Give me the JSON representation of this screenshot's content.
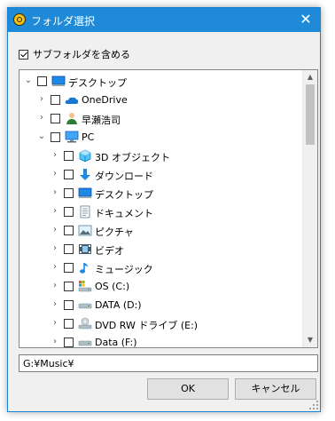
{
  "window": {
    "title": "フォルダ選択",
    "close_glyph": "✕"
  },
  "subfolders": {
    "label": "サブフォルダを含める",
    "checked": true
  },
  "tree": {
    "items": [
      {
        "label": "デスクトップ",
        "icon": "desktop-icon",
        "level": 0,
        "expanded": true
      },
      {
        "label": "OneDrive",
        "icon": "onedrive-cloud-icon",
        "level": 1,
        "expanded": false
      },
      {
        "label": "早瀬浩司",
        "icon": "user-folder-icon",
        "level": 1,
        "expanded": false
      },
      {
        "label": "PC",
        "icon": "pc-icon",
        "level": 1,
        "expanded": true
      },
      {
        "label": "3D オブジェクト",
        "icon": "3d-objects-icon",
        "level": 2,
        "expanded": false
      },
      {
        "label": "ダウンロード",
        "icon": "downloads-icon",
        "level": 2,
        "expanded": false
      },
      {
        "label": "デスクトップ",
        "icon": "desktop-icon",
        "level": 2,
        "expanded": false
      },
      {
        "label": "ドキュメント",
        "icon": "documents-icon",
        "level": 2,
        "expanded": false
      },
      {
        "label": "ピクチャ",
        "icon": "pictures-icon",
        "level": 2,
        "expanded": false
      },
      {
        "label": "ビデオ",
        "icon": "videos-icon",
        "level": 2,
        "expanded": false
      },
      {
        "label": "ミュージック",
        "icon": "music-icon",
        "level": 2,
        "expanded": false
      },
      {
        "label": "OS (C:)",
        "icon": "os-drive-icon",
        "level": 2,
        "expanded": false
      },
      {
        "label": "DATA (D:)",
        "icon": "drive-icon",
        "level": 2,
        "expanded": false
      },
      {
        "label": "DVD RW ドライブ (E:)",
        "icon": "dvd-drive-icon",
        "level": 2,
        "expanded": false
      },
      {
        "label": "Data (F:)",
        "icon": "drive-icon",
        "level": 2,
        "expanded": false
      }
    ]
  },
  "scrollbar": {
    "up_glyph": "▲",
    "down_glyph": "▼"
  },
  "path": {
    "value": "G:¥Music¥"
  },
  "buttons": {
    "ok": "OK",
    "cancel": "キャンセル"
  },
  "colors": {
    "titlebar": "#1f8ad8",
    "accent": "#0078d7"
  }
}
